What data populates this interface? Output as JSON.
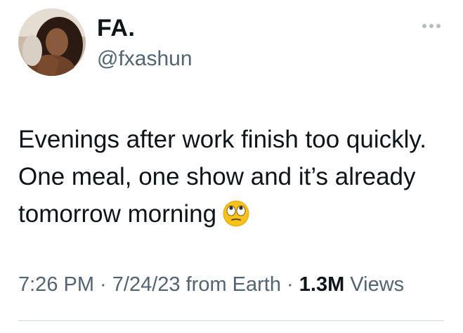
{
  "tweet": {
    "author_name": "FA.",
    "author_handle": "@fxashun",
    "text": "Evenings after work finish too quickly. One meal, one show and it’s already tomorrow morning",
    "emoji": "eye-roll-emoji",
    "time": "7:26 PM",
    "sep1": " · ",
    "date": "7/24/23",
    "source": " from Earth",
    "sep2": " · ",
    "views_count": "1.3M",
    "views_label": " Views",
    "more_icon": "more-horizontal-icon",
    "avatar": "profile-photo"
  },
  "colors": {
    "primary_text": "#0f1419",
    "secondary_text": "#536471",
    "divider": "#cfd9de"
  }
}
